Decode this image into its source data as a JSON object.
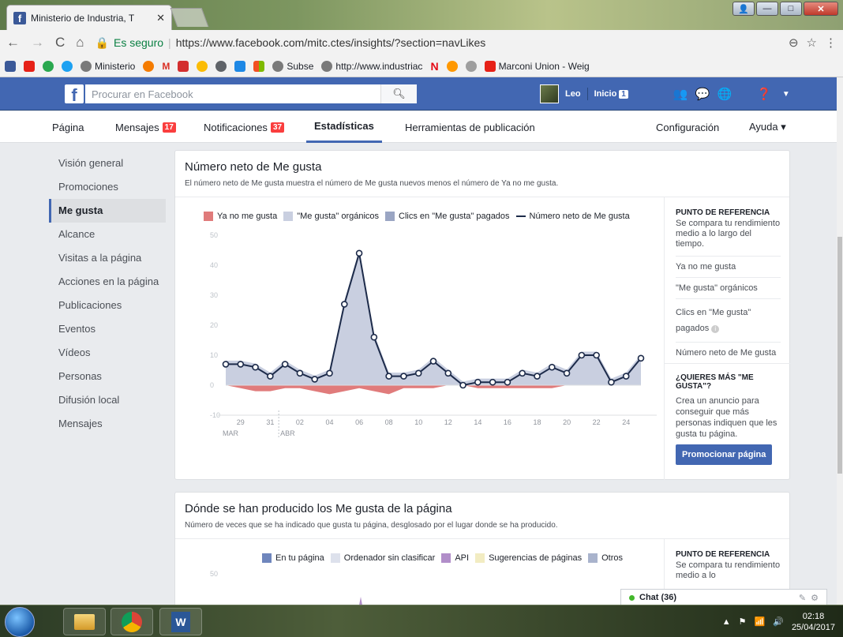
{
  "browser": {
    "tab_title": "Ministerio de Industria, T",
    "url_secure": "Es seguro",
    "url": "https://www.facebook.com/mitc.ctes/insights/?section=navLikes",
    "bookmarks": [
      "Ministerio",
      "M",
      "Subse",
      "http://www.industriac",
      "N",
      "Marconi Union - Weig"
    ]
  },
  "fb": {
    "search_placeholder": "Procurar en Facebook",
    "user": "Leo",
    "home": "Inicio",
    "home_count": "1"
  },
  "tabs": [
    {
      "label": "Página"
    },
    {
      "label": "Mensajes",
      "badge": "17"
    },
    {
      "label": "Notificaciones",
      "badge": "37"
    },
    {
      "label": "Estadísticas"
    },
    {
      "label": "Herramientas de publicación"
    },
    {
      "label": "Configuración"
    },
    {
      "label": "Ayuda ▾"
    }
  ],
  "sidebar": [
    "Visión general",
    "Promociones",
    "Me gusta",
    "Alcance",
    "Visitas a la página",
    "Acciones en la página",
    "Publicaciones",
    "Eventos",
    "Vídeos",
    "Personas",
    "Difusión local",
    "Mensajes"
  ],
  "card1": {
    "title": "Número neto de Me gusta",
    "subtitle": "El número neto de Me gusta muestra el número de Me gusta nuevos menos el número de Ya no me gusta.",
    "legend": [
      "Ya no me gusta",
      "\"Me gusta\" orgánicos",
      "Clics en \"Me gusta\" pagados",
      "Número neto de Me gusta"
    ],
    "ref_title": "PUNTO DE REFERENCIA",
    "ref_desc": "Se compara tu rendimiento medio a lo largo del tiempo.",
    "ref_rows": [
      "Ya no me gusta",
      "\"Me gusta\" orgánicos",
      "Clics en \"Me gusta\" pagados",
      "Número neto de Me gusta"
    ],
    "cta_title": "¿QUIERES MÁS \"ME GUSTA\"?",
    "cta_desc": "Crea un anuncio para conseguir que más personas indiquen que les gusta tu página.",
    "cta_button": "Promocionar página"
  },
  "card2": {
    "title": "Dónde se han producido los Me gusta de la página",
    "subtitle": "Número de veces que se ha indicado que gusta tu página, desglosado por el lugar donde se ha producido.",
    "legend": [
      "En tu página",
      "Ordenador sin clasificar",
      "API",
      "Sugerencias de páginas",
      "Otros"
    ],
    "ref_title": "PUNTO DE REFERENCIA",
    "ref_desc": "Se compara tu rendimiento medio a lo",
    "ytick": "50"
  },
  "chat": "Chat (36)",
  "clock": {
    "time": "02:18",
    "date": "25/04/2017"
  },
  "colors": {
    "unlike": "#e07b7b",
    "organic": "#c9cfe0",
    "paid": "#9aa5c3",
    "net": "#1d2b4a",
    "fb_blue": "#4267b2"
  },
  "chart_data": {
    "type": "line",
    "title": "Número neto de Me gusta",
    "x_ticks": [
      "29",
      "31",
      "02",
      "04",
      "06",
      "08",
      "10",
      "12",
      "14",
      "16",
      "18",
      "20",
      "22",
      "24"
    ],
    "month_labels": [
      "MAR",
      "ABR"
    ],
    "y_ticks": [
      50,
      40,
      30,
      20,
      10,
      0,
      -10
    ],
    "ylim": [
      -10,
      50
    ],
    "series": [
      {
        "name": "Número neto de Me gusta",
        "values": [
          7,
          7,
          6,
          3,
          7,
          4,
          2,
          4,
          27,
          44,
          16,
          3,
          3,
          4,
          8,
          4,
          0,
          1,
          1,
          1,
          4,
          3,
          6,
          4,
          10,
          10,
          1,
          3,
          9
        ]
      },
      {
        "name": "Ya no me gusta",
        "values": [
          0,
          -1,
          -2,
          -2,
          -1,
          -1,
          -2,
          -3,
          -2,
          -1,
          -2,
          -3,
          -1,
          -1,
          -1,
          0,
          0,
          -1,
          -1,
          -1,
          -1,
          -1,
          -1,
          0,
          0,
          0,
          0,
          0,
          0
        ]
      }
    ]
  }
}
